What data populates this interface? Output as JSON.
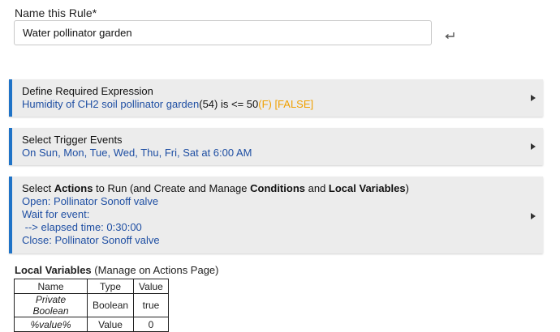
{
  "name_field": {
    "label": "Name this Rule*",
    "value": "Water pollinator garden"
  },
  "sections": {
    "expression": {
      "title": "Define Required Expression",
      "parts": {
        "pre": "Humidity of CH2 soil pollinator garden",
        "open_paren": "(",
        "current": "54",
        "mid": ") is <= 50",
        "eval": "(F) [FALSE]"
      }
    },
    "trigger": {
      "title": "Select Trigger Events",
      "line": "On Sun, Mon, Tue, Wed, Thu, Fri, Sat at 6:00 AM"
    },
    "actions": {
      "title_parts": {
        "t1": "Select ",
        "b1": "Actions",
        "t2": " to Run (and Create and Manage ",
        "b2": "Conditions",
        "t3": " and ",
        "b3": "Local Variables",
        "t4": ")"
      },
      "lines": [
        "Open: Pollinator Sonoff valve",
        "Wait for event:",
        " --> elapsed time: 0:30:00",
        "Close: Pollinator Sonoff valve"
      ]
    }
  },
  "local_variables": {
    "heading_bold": "Local Variables",
    "heading_rest": " (Manage on Actions Page)",
    "columns": [
      "Name",
      "Type",
      "Value"
    ],
    "rows": [
      [
        "Private Boolean",
        "Boolean",
        "true"
      ],
      [
        "%value%",
        "Value",
        "0"
      ]
    ]
  }
}
